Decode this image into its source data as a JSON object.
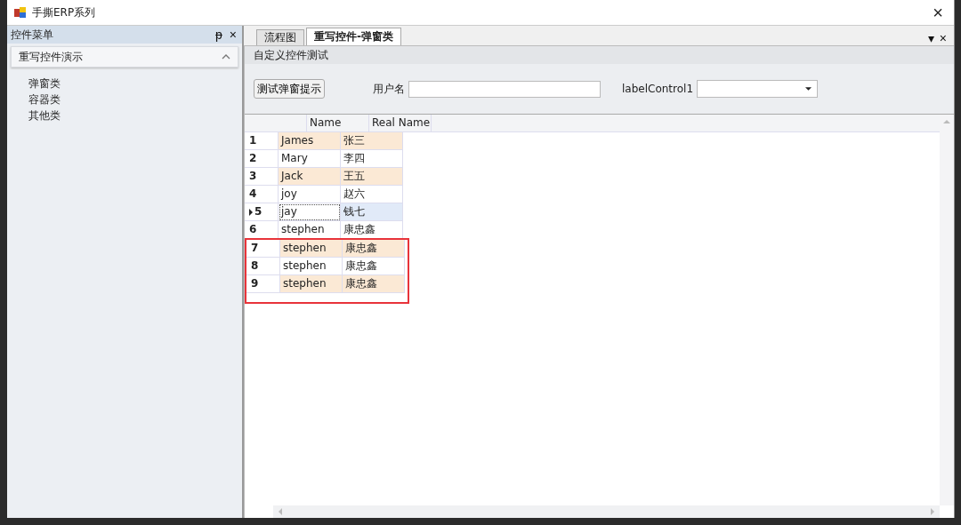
{
  "window": {
    "title": "手撕ERP系列",
    "close": "×"
  },
  "side_panel": {
    "title": "控件菜单",
    "pin": "ᵽ",
    "close": "×",
    "group": {
      "label": "重写控件演示",
      "expanded": true,
      "items": [
        "弹窗类",
        "容器类",
        "其他类"
      ]
    }
  },
  "tabs": [
    {
      "label": "流程图",
      "selected": false
    },
    {
      "label": "重写控件-弹窗类",
      "selected": true
    }
  ],
  "tab_controls": {
    "menu": "▾",
    "close": "×"
  },
  "group_title": "自定义控件测试",
  "form": {
    "button": "测试弹窗提示",
    "username_label": "用户名",
    "combo_label": "labelControl1"
  },
  "table": {
    "columns": [
      "Name",
      "Real Name"
    ],
    "rows": [
      {
        "index": "1",
        "name": "James",
        "real_name": "张三",
        "selected": false,
        "highlighted": false
      },
      {
        "index": "2",
        "name": "Mary",
        "real_name": "李四",
        "selected": false,
        "highlighted": false
      },
      {
        "index": "3",
        "name": "Jack",
        "real_name": "王五",
        "selected": false,
        "highlighted": false
      },
      {
        "index": "4",
        "name": "joy",
        "real_name": "赵六",
        "selected": false,
        "highlighted": false
      },
      {
        "index": "5",
        "name": "jay",
        "real_name": "钱七",
        "selected": true,
        "highlighted": false
      },
      {
        "index": "6",
        "name": "stephen",
        "real_name": "康忠鑫",
        "selected": false,
        "highlighted": false
      },
      {
        "index": "7",
        "name": "stephen",
        "real_name": "康忠鑫",
        "selected": false,
        "highlighted": true
      },
      {
        "index": "8",
        "name": "stephen",
        "real_name": "康忠鑫",
        "selected": false,
        "highlighted": true
      },
      {
        "index": "9",
        "name": "stephen",
        "real_name": "康忠鑫",
        "selected": false,
        "highlighted": true
      }
    ]
  }
}
